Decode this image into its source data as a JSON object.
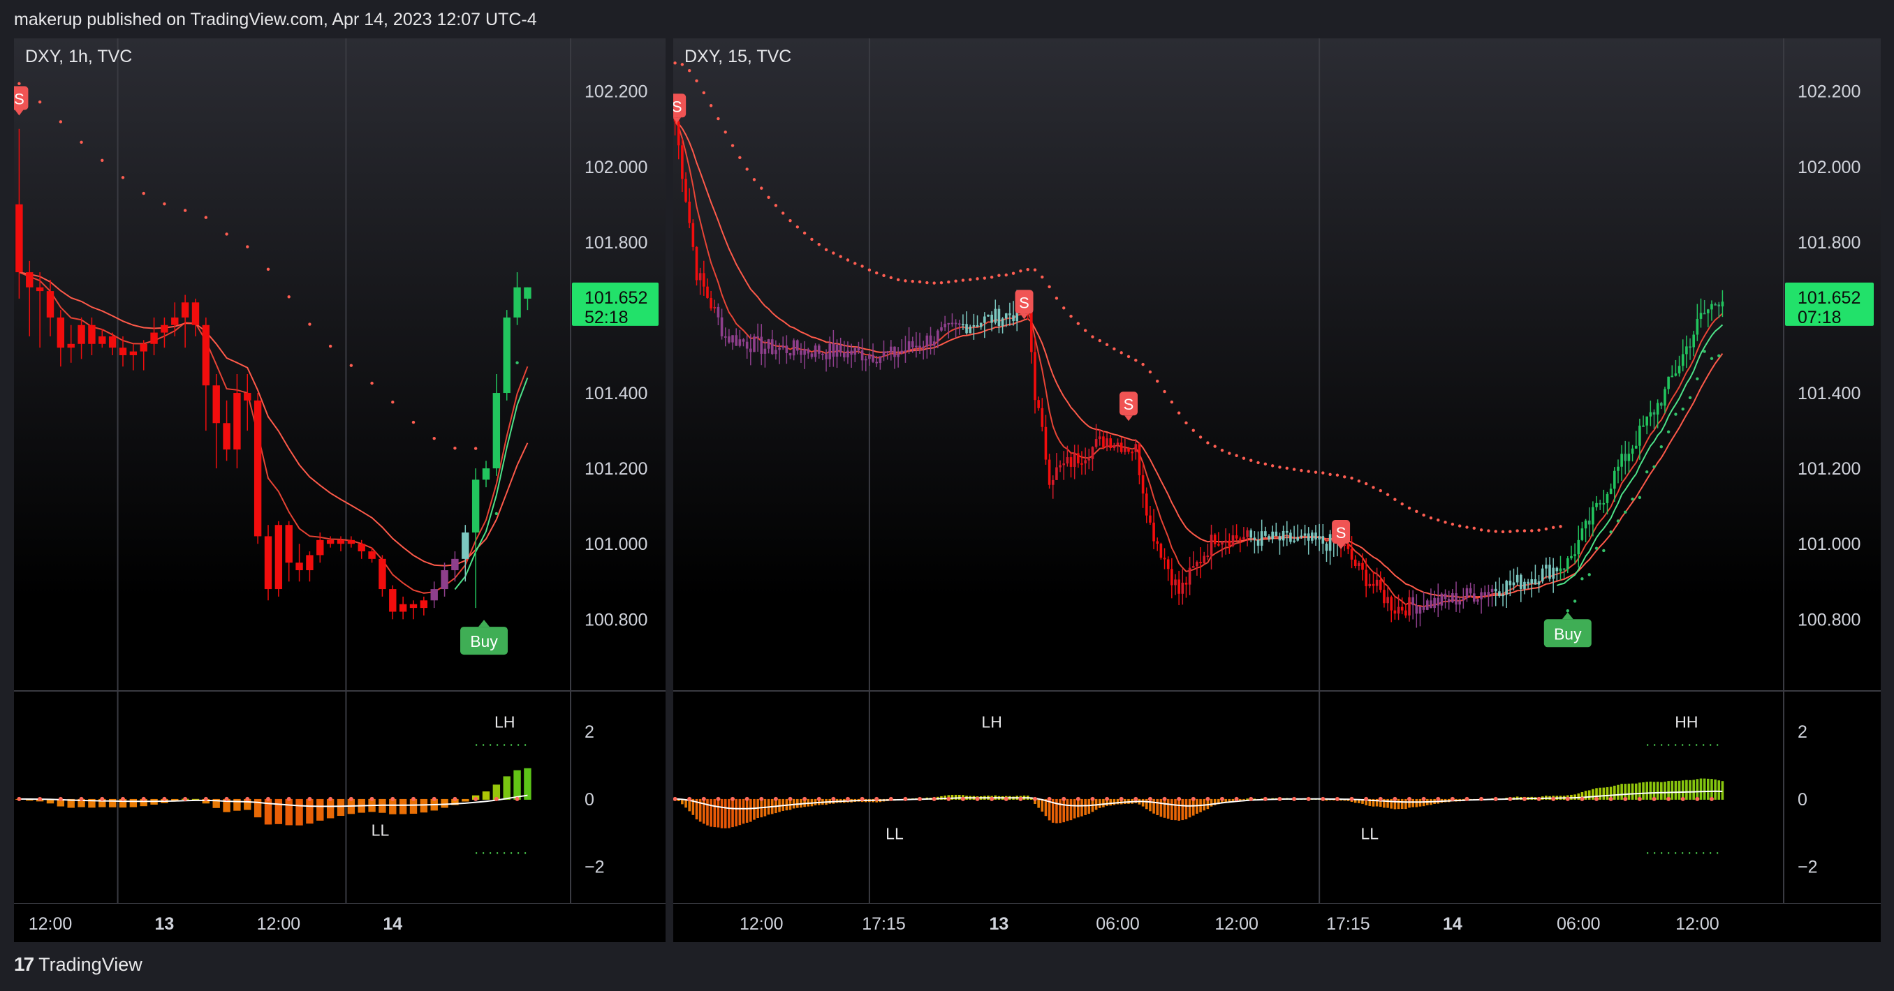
{
  "header": {
    "publisher_line": "makerup published on TradingView.com, Apr 14, 2023 12:07 UTC-4"
  },
  "footer": {
    "brand_name": "TradingView",
    "logo_icon": "tradingview-logo-icon"
  },
  "colors": {
    "bull": "#22c55e",
    "bear": "#f20d0d",
    "mid": "#8e3f8c",
    "teal": "#7cc7c0",
    "price_tag": "#22e16a",
    "sell_badge": "#f05454",
    "buy_badge": "#3fae55"
  },
  "charts": [
    {
      "id": "left",
      "symbol_label": "DXY, 1h, TVC",
      "price_ticks": [
        "102.200",
        "102.000",
        "101.800",
        "101.400",
        "101.200",
        "101.000",
        "100.800"
      ],
      "price_tick_values": [
        102.2,
        102.0,
        101.8,
        101.4,
        101.2,
        101.0,
        100.8
      ],
      "price_range": [
        100.61,
        102.34
      ],
      "last_price": "101.652",
      "countdown": "52:18",
      "osc_ticks": [
        "2",
        "0",
        "−2"
      ],
      "osc_tick_values": [
        2,
        0,
        -2
      ],
      "osc_range": [
        -3.1,
        3.2
      ],
      "time_labels": [
        {
          "text": "12:00",
          "bold": false,
          "bar": 3
        },
        {
          "text": "13",
          "bold": true,
          "bar": 14
        },
        {
          "text": "12:00",
          "bold": false,
          "bar": 25
        },
        {
          "text": "14",
          "bold": true,
          "bar": 36
        }
      ],
      "vlines_bars": [
        9.5,
        31.5
      ],
      "signals": [
        {
          "type": "sell",
          "text": "S",
          "bar": 0,
          "price": 102.18
        },
        {
          "type": "buy",
          "text": "Buy",
          "bar": 44.8,
          "price": 100.78
        }
      ],
      "osc_labels": [
        {
          "text": "LH",
          "bar": 46.8,
          "value": 2.3
        },
        {
          "text": "LL",
          "bar": 34.8,
          "value": -0.9
        }
      ],
      "candles": [
        {
          "o": 101.9,
          "h": 102.1,
          "l": 101.65,
          "c": 101.72
        },
        {
          "o": 101.72,
          "h": 101.75,
          "l": 101.55,
          "c": 101.68
        },
        {
          "o": 101.68,
          "h": 101.72,
          "l": 101.52,
          "c": 101.67
        },
        {
          "o": 101.67,
          "h": 101.7,
          "l": 101.55,
          "c": 101.6
        },
        {
          "o": 101.6,
          "h": 101.62,
          "l": 101.47,
          "c": 101.52
        },
        {
          "o": 101.52,
          "h": 101.58,
          "l": 101.48,
          "c": 101.53
        },
        {
          "o": 101.53,
          "h": 101.6,
          "l": 101.49,
          "c": 101.58
        },
        {
          "o": 101.58,
          "h": 101.6,
          "l": 101.5,
          "c": 101.53
        },
        {
          "o": 101.53,
          "h": 101.57,
          "l": 101.52,
          "c": 101.55
        },
        {
          "o": 101.55,
          "h": 101.56,
          "l": 101.5,
          "c": 101.52
        },
        {
          "o": 101.52,
          "h": 101.55,
          "l": 101.47,
          "c": 101.5
        },
        {
          "o": 101.5,
          "h": 101.53,
          "l": 101.46,
          "c": 101.51
        },
        {
          "o": 101.51,
          "h": 101.54,
          "l": 101.46,
          "c": 101.53
        },
        {
          "o": 101.53,
          "h": 101.6,
          "l": 101.5,
          "c": 101.56
        },
        {
          "o": 101.56,
          "h": 101.6,
          "l": 101.52,
          "c": 101.58
        },
        {
          "o": 101.58,
          "h": 101.64,
          "l": 101.55,
          "c": 101.6
        },
        {
          "o": 101.6,
          "h": 101.66,
          "l": 101.52,
          "c": 101.64
        },
        {
          "o": 101.64,
          "h": 101.65,
          "l": 101.55,
          "c": 101.58
        },
        {
          "o": 101.58,
          "h": 101.6,
          "l": 101.3,
          "c": 101.42
        },
        {
          "o": 101.42,
          "h": 101.45,
          "l": 101.2,
          "c": 101.32
        },
        {
          "o": 101.32,
          "h": 101.38,
          "l": 101.22,
          "c": 101.25
        },
        {
          "o": 101.25,
          "h": 101.45,
          "l": 101.2,
          "c": 101.4
        },
        {
          "o": 101.4,
          "h": 101.45,
          "l": 101.3,
          "c": 101.38
        },
        {
          "o": 101.38,
          "h": 101.4,
          "l": 101.0,
          "c": 101.02
        },
        {
          "o": 101.02,
          "h": 101.05,
          "l": 100.85,
          "c": 100.88
        },
        {
          "o": 100.88,
          "h": 101.06,
          "l": 100.86,
          "c": 101.05
        },
        {
          "o": 101.05,
          "h": 101.06,
          "l": 100.9,
          "c": 100.95
        },
        {
          "o": 100.95,
          "h": 101.0,
          "l": 100.9,
          "c": 100.93
        },
        {
          "o": 100.93,
          "h": 100.98,
          "l": 100.9,
          "c": 100.97
        },
        {
          "o": 100.97,
          "h": 101.03,
          "l": 100.95,
          "c": 101.01
        },
        {
          "o": 101.01,
          "h": 101.02,
          "l": 100.99,
          "c": 101.0
        },
        {
          "o": 101.0,
          "h": 101.02,
          "l": 100.98,
          "c": 101.01
        },
        {
          "o": 101.01,
          "h": 101.02,
          "l": 100.99,
          "c": 101.0
        },
        {
          "o": 101.0,
          "h": 101.01,
          "l": 100.96,
          "c": 100.98
        },
        {
          "o": 100.98,
          "h": 100.99,
          "l": 100.95,
          "c": 100.96
        },
        {
          "o": 100.96,
          "h": 100.97,
          "l": 100.86,
          "c": 100.88
        },
        {
          "o": 100.88,
          "h": 100.89,
          "l": 100.8,
          "c": 100.82
        },
        {
          "o": 100.82,
          "h": 100.86,
          "l": 100.8,
          "c": 100.84
        },
        {
          "o": 100.84,
          "h": 100.85,
          "l": 100.8,
          "c": 100.83
        },
        {
          "o": 100.83,
          "h": 100.86,
          "l": 100.81,
          "c": 100.85
        },
        {
          "o": 100.85,
          "h": 100.9,
          "l": 100.83,
          "c": 100.88
        },
        {
          "o": 100.88,
          "h": 100.95,
          "l": 100.86,
          "c": 100.93
        },
        {
          "o": 100.93,
          "h": 100.98,
          "l": 100.9,
          "c": 100.96
        },
        {
          "o": 100.96,
          "h": 101.05,
          "l": 100.9,
          "c": 101.03
        },
        {
          "o": 101.03,
          "h": 101.2,
          "l": 100.83,
          "c": 101.17
        },
        {
          "o": 101.17,
          "h": 101.22,
          "l": 101.15,
          "c": 101.2
        },
        {
          "o": 101.2,
          "h": 101.45,
          "l": 101.18,
          "c": 101.4
        },
        {
          "o": 101.4,
          "h": 101.62,
          "l": 101.38,
          "c": 101.6
        },
        {
          "o": 101.6,
          "h": 101.72,
          "l": 101.58,
          "c": 101.68
        },
        {
          "o": 101.68,
          "h": 101.68,
          "l": 101.62,
          "c": 101.65
        }
      ]
    },
    {
      "id": "right",
      "symbol_label": "DXY, 15, TVC",
      "price_ticks": [
        "102.200",
        "102.000",
        "101.800",
        "101.400",
        "101.200",
        "101.000",
        "100.800"
      ],
      "price_tick_values": [
        102.2,
        102.0,
        101.8,
        101.4,
        101.2,
        101.0,
        100.8
      ],
      "price_range": [
        100.61,
        102.34
      ],
      "last_price": "101.652",
      "countdown": "07:18",
      "osc_ticks": [
        "2",
        "0",
        "−2"
      ],
      "osc_tick_values": [
        2,
        0,
        -2
      ],
      "osc_range": [
        -3.1,
        3.2
      ],
      "time_labels": [
        {
          "text": "12:00",
          "bold": false,
          "bar": 24
        },
        {
          "text": "17:15",
          "bold": false,
          "bar": 58
        },
        {
          "text": "13",
          "bold": true,
          "bar": 90
        },
        {
          "text": "06:00",
          "bold": false,
          "bar": 123
        },
        {
          "text": "12:00",
          "bold": false,
          "bar": 156
        },
        {
          "text": "17:15",
          "bold": false,
          "bar": 187
        },
        {
          "text": "14",
          "bold": true,
          "bar": 216
        },
        {
          "text": "06:00",
          "bold": false,
          "bar": 251
        },
        {
          "text": "12:00",
          "bold": false,
          "bar": 284
        }
      ],
      "vlines_bars": [
        54,
        179
      ],
      "signals": [
        {
          "type": "sell",
          "text": "S",
          "bar": 0.5,
          "price": 102.16
        },
        {
          "type": "sell",
          "text": "S",
          "bar": 97,
          "price": 101.64
        },
        {
          "type": "sell",
          "text": "S",
          "bar": 126,
          "price": 101.37
        },
        {
          "type": "sell",
          "text": "S",
          "bar": 185,
          "price": 101.03
        },
        {
          "type": "buy",
          "text": "Buy",
          "bar": 248,
          "price": 100.8
        }
      ],
      "osc_labels": [
        {
          "text": "LH",
          "bar": 88,
          "value": 2.3
        },
        {
          "text": "LL",
          "bar": 61,
          "value": -1.0
        },
        {
          "text": "LL",
          "bar": 193,
          "value": -1.0
        },
        {
          "text": "HH",
          "bar": 281,
          "value": 2.3
        }
      ]
    }
  ]
}
